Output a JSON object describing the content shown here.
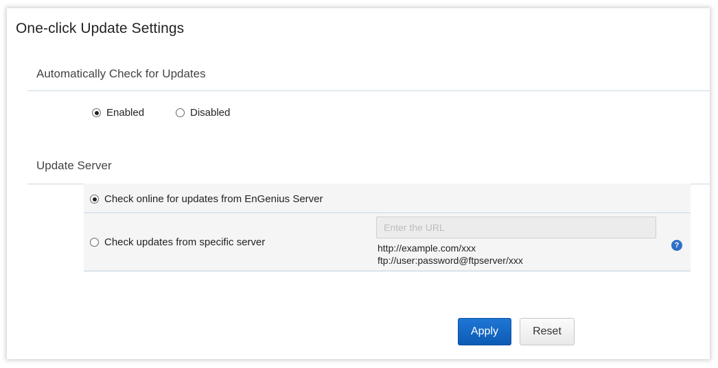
{
  "page": {
    "title": "One-click Update Settings"
  },
  "auto_check": {
    "title": "Automatically Check for Updates",
    "options": [
      {
        "label": "Enabled",
        "selected": true
      },
      {
        "label": "Disabled",
        "selected": false
      }
    ]
  },
  "update_server": {
    "title": "Update Server",
    "options": [
      {
        "label": "Check online for updates from EnGenius Server",
        "selected": true
      },
      {
        "label": "Check updates from specific server",
        "selected": false
      }
    ],
    "url_placeholder": "Enter the URL",
    "url_value": "",
    "hints": [
      "http://example.com/xxx",
      "ftp://user:password@ftpserver/xxx"
    ],
    "help_icon": "?"
  },
  "buttons": {
    "apply": "Apply",
    "reset": "Reset"
  },
  "colors": {
    "accent": "#1668c9",
    "divider": "#c9d9e3",
    "help": "#2f6fc6"
  }
}
